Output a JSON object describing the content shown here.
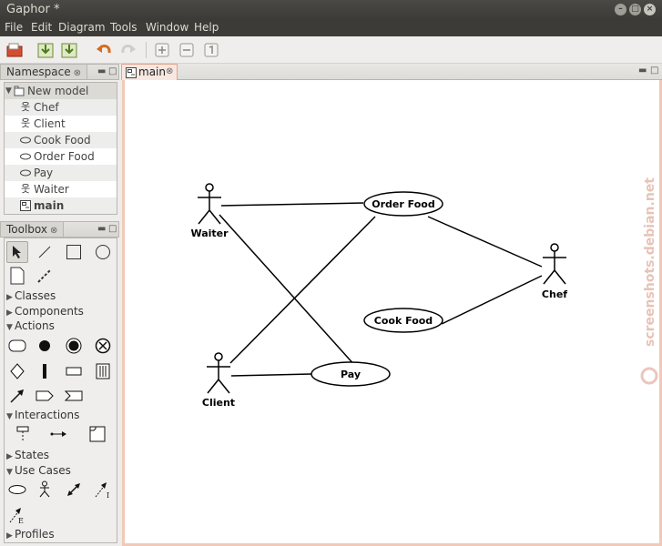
{
  "window": {
    "title": "Gaphor *"
  },
  "menu": [
    "File",
    "Edit",
    "Diagram",
    "Tools",
    "Window",
    "Help"
  ],
  "namespace": {
    "tab_label": "Namespace",
    "root": "New model",
    "items": [
      {
        "label": "Chef",
        "icon": "actor-icon"
      },
      {
        "label": "Client",
        "icon": "actor-icon"
      },
      {
        "label": "Cook Food",
        "icon": "usecase-icon"
      },
      {
        "label": "Order Food",
        "icon": "usecase-icon"
      },
      {
        "label": "Pay",
        "icon": "usecase-icon"
      },
      {
        "label": "Waiter",
        "icon": "actor-icon"
      },
      {
        "label": "main",
        "icon": "diagram-icon"
      }
    ]
  },
  "toolbox": {
    "tab_label": "Toolbox",
    "sections": {
      "classes": "Classes",
      "components": "Components",
      "actions": "Actions",
      "interactions": "Interactions",
      "states": "States",
      "use_cases": "Use Cases",
      "profiles": "Profiles"
    }
  },
  "diagram": {
    "tab_label": "main",
    "actors": [
      "Waiter",
      "Client",
      "Chef"
    ],
    "usecases": [
      "Order Food",
      "Cook Food",
      "Pay"
    ]
  },
  "watermark": "screenshots.debian.net",
  "colors": {
    "accent": "#e0a58f",
    "titlebar": "#3c3b37"
  }
}
